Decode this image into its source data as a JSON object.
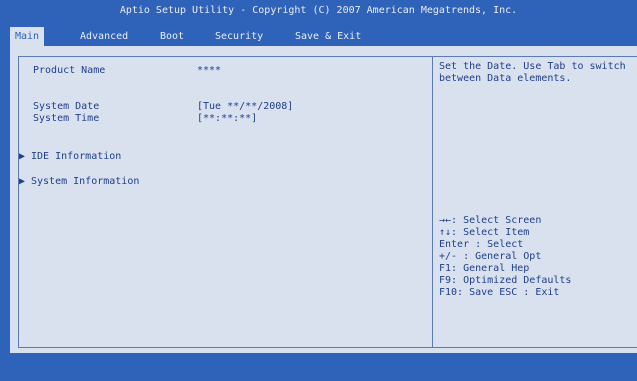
{
  "title": "Aptio Setup Utility - Copyright (C) 2007 American Megatrends, Inc.",
  "tabs": [
    "Main",
    "Advanced",
    "Boot",
    "Security",
    "Save & Exit"
  ],
  "main": {
    "product_name_label": "Product Name",
    "product_name_value": "****",
    "system_date_label": "System Date",
    "system_date_value": "[Tue  **/**/2008]",
    "system_time_label": "System Time",
    "system_time_value": "[**:**:**]",
    "submenus": [
      "IDE Information",
      "System Information"
    ],
    "submenu_arrow": "▶"
  },
  "help": {
    "description": [
      "Set the Date. Use Tab to switch",
      "between Data elements."
    ],
    "keys": [
      "→←: Select Screen",
      "↑↓: Select Item",
      "Enter : Select",
      "+/- : General Opt",
      "F1: General Hep",
      "F9: Optimized Defaults",
      "F10: Save    ESC : Exit"
    ]
  },
  "colors": {
    "background": "#2f62b9",
    "panel": "#d9e1ef",
    "text": "#1f3f8a"
  }
}
